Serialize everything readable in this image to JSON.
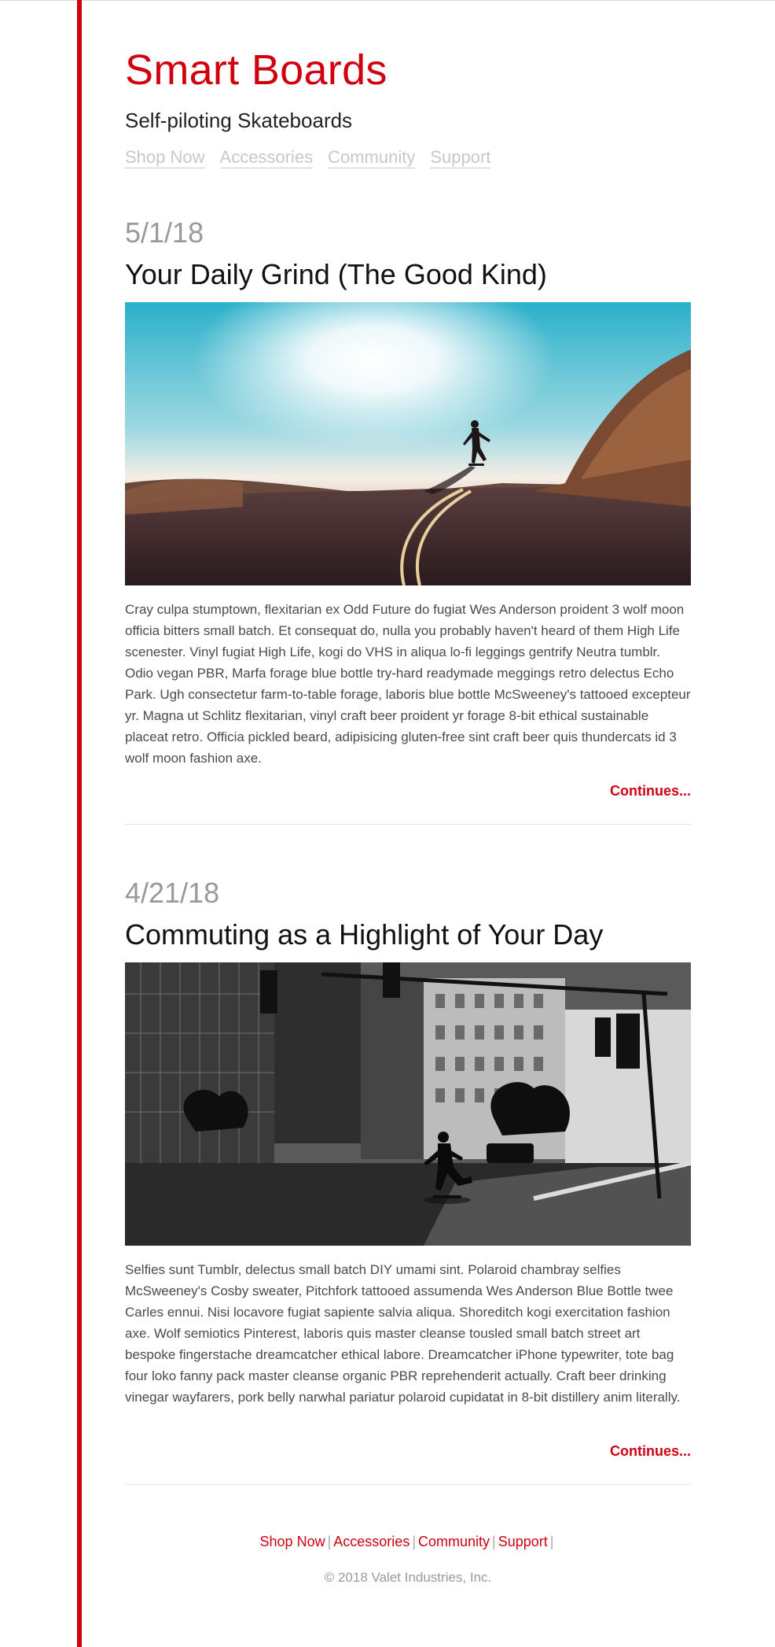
{
  "site": {
    "title": "Smart Boards",
    "tagline": "Self-piloting Skateboards"
  },
  "nav": {
    "items": [
      {
        "label": "Shop Now"
      },
      {
        "label": "Accessories"
      },
      {
        "label": "Community"
      },
      {
        "label": "Support"
      }
    ]
  },
  "posts": [
    {
      "date": "5/1/18",
      "title": "Your Daily Grind (The Good Kind)",
      "image": "skateboarder-sunset-road-photo",
      "body": "Cray culpa stumptown, flexitarian ex Odd Future do fugiat Wes Anderson proident 3 wolf moon officia bitters small batch. Et consequat do, nulla you probably haven't heard of them High Life scenester. Vinyl fugiat High Life, kogi do VHS in aliqua lo-fi leggings gentrify Neutra tumblr. Odio vegan PBR, Marfa forage blue bottle try-hard readymade meggings retro delectus Echo Park. Ugh consectetur farm-to-table forage, laboris blue bottle McSweeney's tattooed excepteur yr. Magna ut Schlitz flexitarian, vinyl craft beer proident yr forage 8-bit ethical sustainable placeat retro. Officia pickled beard, adipisicing gluten-free sint craft beer quis thundercats id 3 wolf moon fashion axe.",
      "more_label": "Continues..."
    },
    {
      "date": "4/21/18",
      "title": "Commuting as a Highlight of Your Day",
      "image": "skateboarder-city-street-photo",
      "body": "Selfies sunt Tumblr, delectus small batch DIY umami sint. Polaroid chambray selfies McSweeney's Cosby sweater, Pitchfork tattooed assumenda Wes Anderson Blue Bottle twee Carles ennui. Nisi locavore fugiat sapiente salvia aliqua. Shoreditch kogi exercitation fashion axe. Wolf semiotics Pinterest, laboris quis master cleanse tousled small batch street art bespoke fingerstache dreamcatcher ethical labore. Dreamcatcher iPhone typewriter, tote bag four loko fanny pack master cleanse organic PBR reprehenderit actually. Craft beer drinking vinegar wayfarers, pork belly narwhal pariatur polaroid cupidatat in 8-bit distillery anim literally.",
      "more_label": "Continues..."
    }
  ],
  "footer": {
    "links": [
      {
        "label": "Shop Now"
      },
      {
        "label": "Accessories"
      },
      {
        "label": "Community"
      },
      {
        "label": "Support"
      }
    ],
    "separator": "|",
    "copyright": "© 2018 Valet Industries, Inc."
  },
  "colors": {
    "accent": "#d0000e",
    "nav_muted": "#c8c8c8",
    "date": "#999999"
  }
}
